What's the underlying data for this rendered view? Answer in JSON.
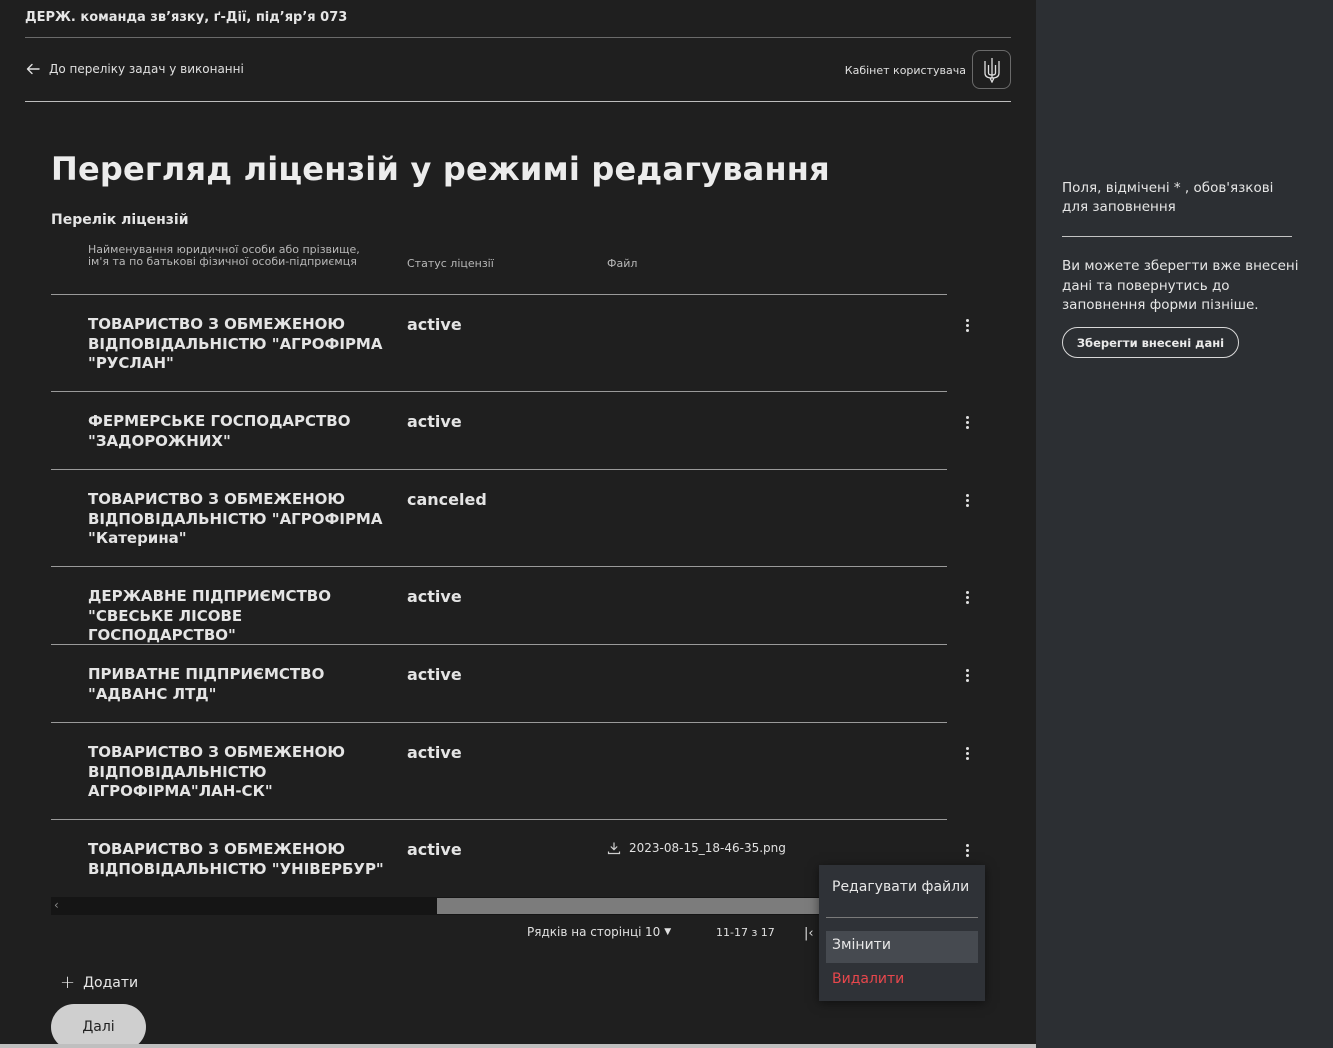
{
  "header": {
    "org_name": "ДЕРЖ. команда зв’язку, ґ-Дії, під’яр’я 073",
    "back_link": "До переліку задач у виконанні",
    "cabinet_link": "Кабінет користувача",
    "trident_icon": "trident-icon"
  },
  "page": {
    "title": "Перегляд ліцензій у режимі редагування",
    "subtitle": "Перелік ліцензій"
  },
  "table": {
    "columns": {
      "name": "Найменування юридичної особи або прізвище, ім'я та по батькові фізичної особи-підприємця",
      "status": "Статус ліцензії",
      "file": "Файл"
    },
    "rows": [
      {
        "name": "ТОВАРИСТВО З ОБМЕЖЕНОЮ ВІДПОВІДАЛЬНІСТЮ \"АГРОФІРМА \"РУСЛАН\"",
        "status": "active",
        "file": ""
      },
      {
        "name": "ФЕРМЕРСЬКЕ ГОСПОДАРСТВО \"ЗАДОРОЖНИХ\"",
        "status": "active",
        "file": ""
      },
      {
        "name": "ТОВАРИСТВО З ОБМЕЖЕНОЮ ВІДПОВІДАЛЬНІСТЮ \"АГРОФІРМА \"Катерина\"",
        "status": "canceled",
        "file": ""
      },
      {
        "name": "ДЕРЖАВНЕ ПІДПРИЄМСТВО \"СВЕСЬКЕ ЛІСОВЕ ГОСПОДАРСТВО\"",
        "status": "active",
        "file": ""
      },
      {
        "name": "ПРИВАТНЕ ПІДПРИЄМСТВО \"АДВАНС ЛТД\"",
        "status": "active",
        "file": ""
      },
      {
        "name": "ТОВАРИСТВО З ОБМЕЖЕНОЮ ВІДПОВІДАЛЬНІСТЮ АГРОФІРМА\"ЛАН-СК\"",
        "status": "active",
        "file": ""
      },
      {
        "name": "ТОВАРИСТВО З ОБМЕЖЕНОЮ ВІДПОВІДАЛЬНІСТЮ \"УНІВЕРБУР\"",
        "status": "active",
        "file": "2023-08-15_18-46-35.png"
      }
    ]
  },
  "pager": {
    "rows_label": "Рядків на сторінці",
    "rows_value": "10",
    "range": "11-17 з 17"
  },
  "actions": {
    "add": "Додати",
    "next": "Далі"
  },
  "context_menu": {
    "edit_files": "Редагувати файли",
    "change": "Змінити",
    "delete": "Видалити",
    "delete_color": "#e8474c"
  },
  "sidebar": {
    "required_note": "Поля, відмічені * , обов'язкові для заповнення",
    "save_info": "Ви можете зберегти вже внесені дані та повернутись до заповнення форми пізніше.",
    "save_button": "Зберегти внесені дані"
  }
}
